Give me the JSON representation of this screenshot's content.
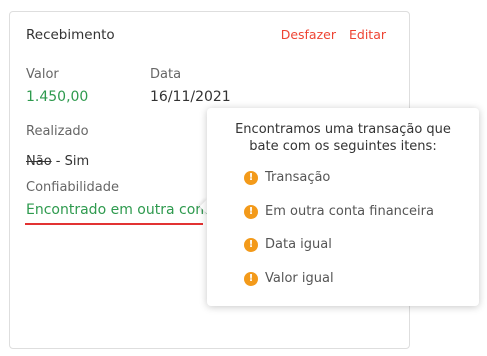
{
  "card": {
    "title": "Recebimento",
    "actions": {
      "undo": "Desfazer",
      "edit": "Editar"
    },
    "value": {
      "label": "Valor",
      "amount": "1.450,00"
    },
    "date": {
      "label": "Data",
      "value": "16/11/2021"
    },
    "done": {
      "label": "Realizado",
      "no": "Não",
      "separator": " - ",
      "yes": "Sim"
    },
    "reliability": {
      "label": "Confiabilidade",
      "value": "Encontrado em outra conta"
    }
  },
  "tooltip": {
    "heading_line1": "Encontramos uma transação que",
    "heading_line2": "bate com os seguintes itens:",
    "icon": "warning-icon",
    "items": [
      "Transação",
      "Em outra conta financeira",
      "Data igual",
      "Valor igual"
    ]
  },
  "colors": {
    "accent_red": "#ee4433",
    "success_green": "#2e9a4e",
    "warning_orange": "#f39a1a"
  }
}
